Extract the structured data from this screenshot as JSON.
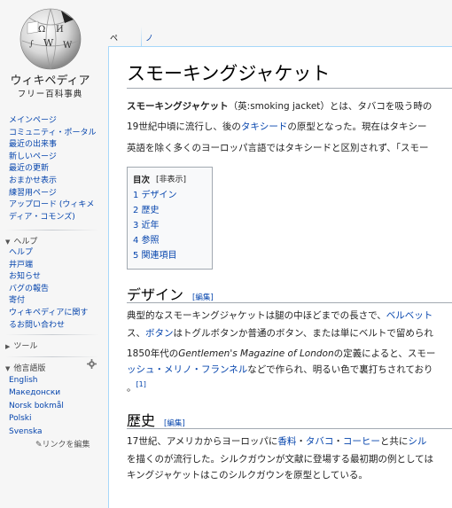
{
  "logo": {
    "title": "ウィキペディア",
    "subtitle": "フリー百科事典"
  },
  "sidebar": {
    "main": [
      "メインページ",
      "コミュニティ・ポータル",
      "最近の出来事",
      "新しいページ",
      "最近の更新",
      "おまかせ表示",
      "練習用ページ",
      "アップロード (ウィキメ",
      "ディア・コモンズ)"
    ],
    "help_label": "ヘルプ",
    "help": [
      "ヘルプ",
      "井戸端",
      "お知らせ",
      "バグの報告",
      "寄付",
      "ウィキペディアに関す",
      "るお問い合わせ"
    ],
    "tools_label": "ツール",
    "languages_label": "他言語版",
    "languages": [
      "English",
      "Македонски",
      "Norsk bokmål",
      "Polski",
      "Svenska"
    ],
    "edit_links": "リンクを編集"
  },
  "tabs": {
    "page": "ページ",
    "note": "ノート"
  },
  "article": {
    "title": "スモーキングジャケット",
    "intro1_bold": "スモーキングジャケット",
    "intro1_rest": "（英:smoking jacket）とは、タバコを吸う時の",
    "intro2_a": "19世紀中頃に流行し、後の",
    "intro2_link": "タキシード",
    "intro2_b": "の原型となった。現在はタキシー",
    "intro3": "英語を除く多くのヨーロッパ言語ではタキシードと区別されず、「スモー",
    "toc": {
      "title": "目次",
      "hide": "[非表示]",
      "items": [
        "1 デザイン",
        "2 歴史",
        "3 近年",
        "4 参照",
        "5 関連項目"
      ]
    },
    "design": {
      "heading": "デザイン",
      "edit": "[編集]",
      "l1_a": "典型的なスモーキングジャケットは腿の中ほどまでの長さで、",
      "l1_link": "ベルベット",
      "l2_a": "ス、",
      "l2_link": "ボタン",
      "l2_b": "はトグルボタンか普通のボタン、または単にベルトで留められ",
      "l3_a": "1850年代の",
      "l3_italic": "Gentlemen's Magazine of London",
      "l3_b": "の定義によると、スモー",
      "l4_link": "ッシュ・メリノ・フランネル",
      "l4_b": "などで作られ、明るい色で裏打ちされており",
      "l5_a": "。",
      "l5_ref": "[1]"
    },
    "history": {
      "heading": "歴史",
      "edit": "[編集]",
      "l1_a": "17世紀、アメリカからヨーロッパに",
      "l1_link1": "香料",
      "l1_sep1": "・",
      "l1_link2": "タバコ",
      "l1_sep2": "・",
      "l1_link3": "コーヒー",
      "l1_b": "と共に",
      "l1_link4": "シル",
      "l2": "を描くのが流行した。シルクガウンが文献に登場する最初期の例としては",
      "l3": "キングジャケットはこのシルクガウンを原型としている。"
    }
  }
}
